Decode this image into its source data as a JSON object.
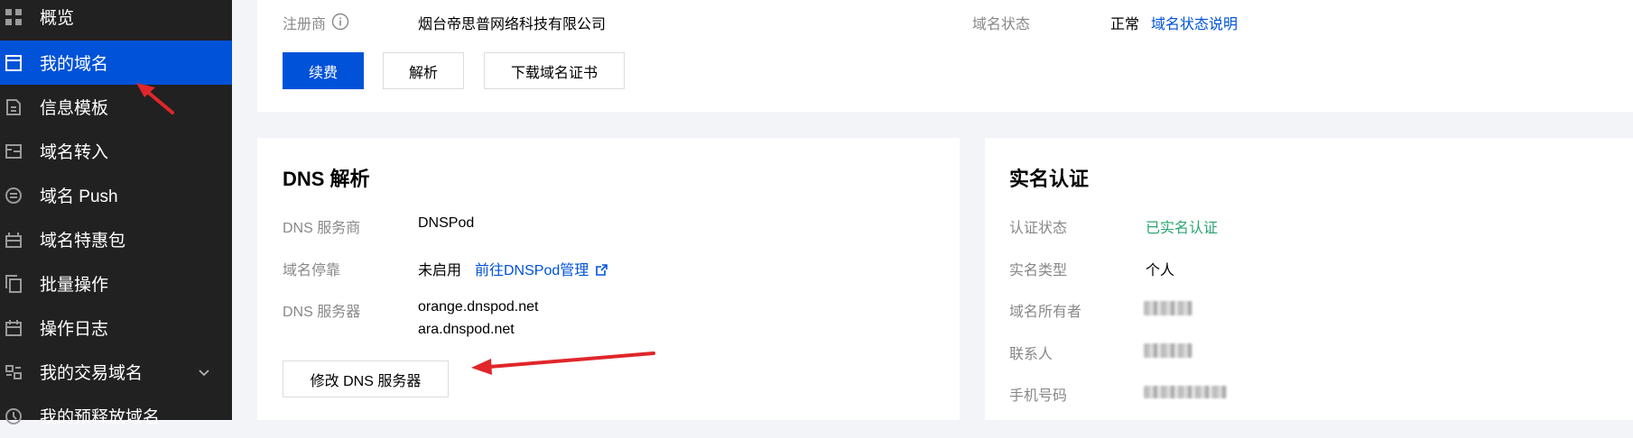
{
  "sidebar": {
    "items": [
      {
        "label": "概览",
        "icon": "grid-icon"
      },
      {
        "label": "我的域名",
        "icon": "browser-window-icon",
        "active": true
      },
      {
        "label": "信息模板",
        "icon": "document-icon"
      },
      {
        "label": "域名转入",
        "icon": "transfer-in-icon"
      },
      {
        "label": "域名 Push",
        "icon": "push-circle-icon"
      },
      {
        "label": "域名特惠包",
        "icon": "package-icon"
      },
      {
        "label": "批量操作",
        "icon": "batch-copy-icon"
      },
      {
        "label": "操作日志",
        "icon": "calendar-icon"
      },
      {
        "label": "我的交易域名",
        "icon": "trade-icon",
        "has_chevron": true
      },
      {
        "label": "我的预释放域名",
        "icon": "release-icon"
      }
    ]
  },
  "top_card": {
    "registrar_label": "注册商",
    "registrar_value": "烟台帝思普网络科技有限公司",
    "status_label": "域名状态",
    "status_value": "正常",
    "status_link": "域名状态说明",
    "buttons": {
      "renew": "续费",
      "resolve": "解析",
      "download_cert": "下载域名证书"
    }
  },
  "dns_card": {
    "title": "DNS 解析",
    "provider_label": "DNS 服务商",
    "provider_value": "DNSPod",
    "parking_label": "域名停靠",
    "parking_value": "未启用",
    "parking_link": "前往DNSPod管理",
    "servers_label": "DNS 服务器",
    "servers": [
      "orange.dnspod.net",
      "ara.dnspod.net"
    ],
    "modify_button": "修改 DNS 服务器"
  },
  "realname_card": {
    "title": "实名认证",
    "status_label": "认证状态",
    "status_value": "已实名认证",
    "type_label": "实名类型",
    "type_value": "个人",
    "owner_label": "域名所有者",
    "contact_label": "联系人",
    "phone_label": "手机号码"
  },
  "colors": {
    "sidebar_bg": "#212121",
    "accent": "#0052d9",
    "success": "#2ba471",
    "annotation_arrow": "#e0262a"
  }
}
